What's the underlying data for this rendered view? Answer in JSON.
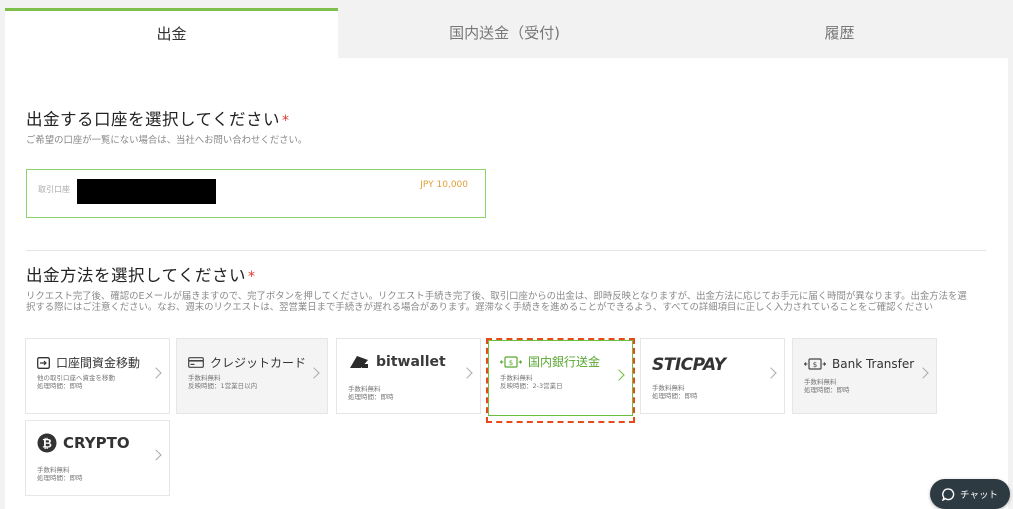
{
  "tabs": [
    {
      "label": "出金",
      "active": true
    },
    {
      "label": "国内送金（受付)",
      "active": false
    },
    {
      "label": "履歴",
      "active": false
    }
  ],
  "account_section": {
    "title": "出金する口座を選択してください",
    "required_mark": "*",
    "note": "ご希望の口座が一覧にない場合は、当社へお問い合わせください。",
    "account_label": "取引口座",
    "account_amount": "JPY 10,000"
  },
  "method_section": {
    "title": "出金方法を選択してください",
    "required_mark": "*",
    "note_line1": "リクエスト完了後、確認のEメールが届きますので、完了ボタンを押してください。リクエスト手続き完了後、取引口座からの出金は、即時反映となりますが、出金方法に応じてお手元に届く時間が異なります。出金方法を選",
    "note_line2": "択する際にはご注意ください。なお、週末のリクエストは、翌営業日まで手続きが遅れる場合があります。遅滞なく手続きを進めることができるよう、すべての詳細項目に正しく入力されていることをご確認ください"
  },
  "methods": [
    {
      "name": "口座間資金移動",
      "icon": "transfer-icon",
      "line1": "他の取引口座へ資金を移動",
      "line2": "処理時間：即時"
    },
    {
      "name": "クレジットカード",
      "icon": "credit-card-icon",
      "line1": "手数料無料",
      "line2": "反映時間：1営業日以内"
    },
    {
      "name": "bitwallet",
      "icon": "bitwallet-icon",
      "line1": "手数料無料",
      "line2": "処理時間：即時"
    },
    {
      "name": "国内銀行送金",
      "icon": "bank-transfer-icon",
      "line1": "手数料無料",
      "line2": "反映時間：2-3営業日"
    },
    {
      "name": "STICPAY",
      "icon": "sticpay-logo",
      "line1": "手数料無料",
      "line2": "処理時間：即時"
    },
    {
      "name": "Bank Transfer",
      "icon": "bank-transfer-icon",
      "line1": "手数料無料",
      "line2": "処理時間：即時"
    },
    {
      "name": "CRYPTO",
      "icon": "bitcoin-icon",
      "line1": "手数料無料",
      "line2": "処理時間：即時"
    }
  ],
  "chat": {
    "label": "チャット"
  },
  "colors": {
    "accent": "#7cc04b",
    "highlight": "#e64a19",
    "required": "#e0392d"
  }
}
